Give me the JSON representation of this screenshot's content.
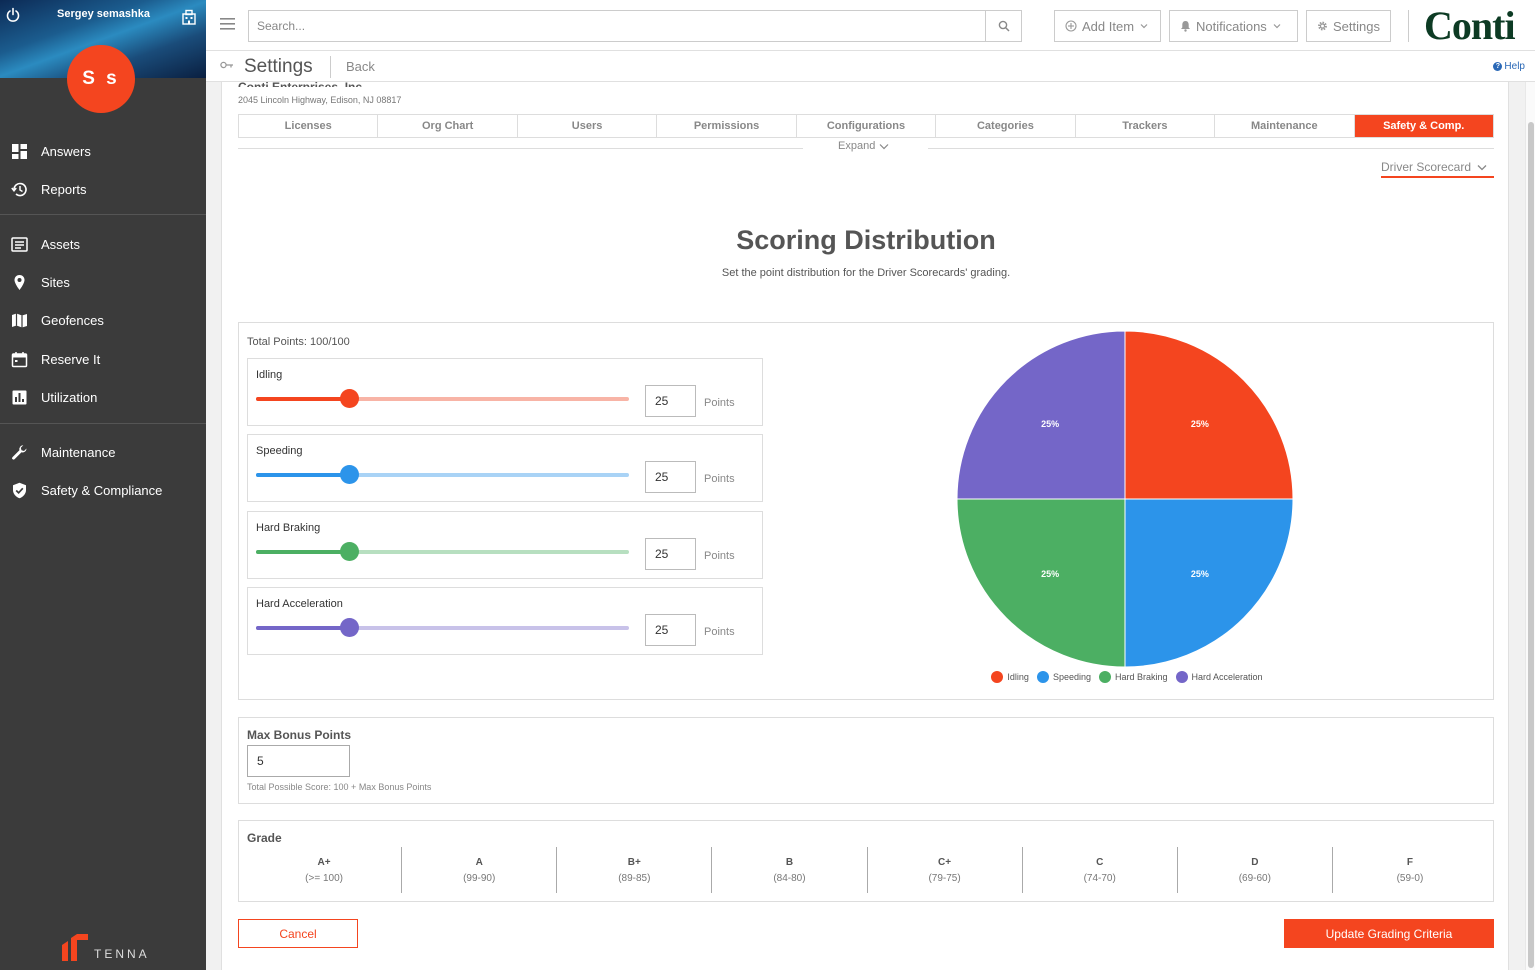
{
  "user": {
    "name": "Sergey semashka",
    "initials": "S s"
  },
  "sidebar": {
    "items": [
      {
        "label": "Answers",
        "icon": "dashboard-icon"
      },
      {
        "label": "Reports",
        "icon": "history-icon"
      },
      {
        "label": "Assets",
        "icon": "list-icon"
      },
      {
        "label": "Sites",
        "icon": "map-pin-icon"
      },
      {
        "label": "Geofences",
        "icon": "map-icon"
      },
      {
        "label": "Reserve It",
        "icon": "calendar-icon"
      },
      {
        "label": "Utilization",
        "icon": "bar-chart-icon"
      },
      {
        "label": "Maintenance",
        "icon": "wrench-icon"
      },
      {
        "label": "Safety & Compliance",
        "icon": "shield-icon"
      }
    ],
    "footer_brand": "TENNA"
  },
  "header": {
    "search_placeholder": "Search...",
    "add_item": "Add Item",
    "notifications": "Notifications",
    "settings": "Settings",
    "logo": "Conti"
  },
  "subheader": {
    "title": "Settings",
    "back": "Back",
    "help": "Help"
  },
  "company": {
    "name": "Conti Enterprises, Inc.",
    "address": "2045 Lincoln Highway, Edison, NJ 08817"
  },
  "tabs": [
    {
      "label": "Licenses",
      "active": false
    },
    {
      "label": "Org Chart",
      "active": false
    },
    {
      "label": "Users",
      "active": false
    },
    {
      "label": "Permissions",
      "active": false
    },
    {
      "label": "Configurations",
      "active": false
    },
    {
      "label": "Categories",
      "active": false
    },
    {
      "label": "Trackers",
      "active": false
    },
    {
      "label": "Maintenance",
      "active": false
    },
    {
      "label": "Safety & Comp.",
      "active": true
    }
  ],
  "expand_label": "Expand",
  "scorecard_dropdown": "Driver Scorecard",
  "section": {
    "title": "Scoring Distribution",
    "subtitle": "Set the point distribution for the Driver Scorecards' grading."
  },
  "distribution": {
    "total_points": "Total Points: 100/100",
    "points_label": "Points",
    "max_points": 100,
    "categories": [
      {
        "label": "Idling",
        "value": "25",
        "fraction": 0.25,
        "color": "#f4451f",
        "track": "#f8b4a6"
      },
      {
        "label": "Speeding",
        "value": "25",
        "fraction": 0.25,
        "color": "#2c94ea",
        "track": "#a9d3f6"
      },
      {
        "label": "Hard Braking",
        "value": "25",
        "fraction": 0.25,
        "color": "#4caf63",
        "track": "#b7dfc0"
      },
      {
        "label": "Hard Acceleration",
        "value": "25",
        "fraction": 0.25,
        "color": "#7466c8",
        "track": "#c8c2e9"
      }
    ]
  },
  "chart_data": {
    "type": "pie",
    "categories": [
      "Idling",
      "Speeding",
      "Hard Braking",
      "Hard Acceleration"
    ],
    "values": [
      25,
      25,
      25,
      25
    ],
    "labels": [
      "25%",
      "25%",
      "25%",
      "25%"
    ],
    "colors": [
      "#f4451f",
      "#2c94ea",
      "#4caf63",
      "#7466c8"
    ],
    "legend": "bottom"
  },
  "bonus": {
    "title": "Max Bonus Points",
    "value": "5",
    "note": "Total Possible Score: 100 + Max Bonus Points"
  },
  "grades": {
    "title": "Grade",
    "items": [
      {
        "letter": "A+",
        "range": "(>= 100)"
      },
      {
        "letter": "A",
        "range": "(99-90)"
      },
      {
        "letter": "B+",
        "range": "(89-85)"
      },
      {
        "letter": "B",
        "range": "(84-80)"
      },
      {
        "letter": "C+",
        "range": "(79-75)"
      },
      {
        "letter": "C",
        "range": "(74-70)"
      },
      {
        "letter": "D",
        "range": "(69-60)"
      },
      {
        "letter": "F",
        "range": "(59-0)"
      }
    ]
  },
  "actions": {
    "cancel": "Cancel",
    "update": "Update Grading Criteria"
  }
}
